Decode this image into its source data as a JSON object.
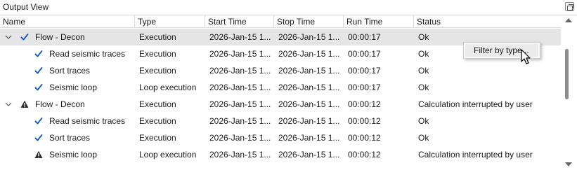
{
  "window": {
    "title": "Output View"
  },
  "columns": [
    "Name",
    "Type",
    "Start Time",
    "Stop Time",
    "Run Time",
    "Status"
  ],
  "rows": [
    {
      "level": 0,
      "expander": "collapse",
      "icon": "check",
      "name": "Flow - Decon",
      "type": "Execution",
      "start": "2026-Jan-15 1...",
      "stop": "2026-Jan-15 1...",
      "run": "00:00:17",
      "status": "Ok"
    },
    {
      "level": 1,
      "expander": "",
      "icon": "check",
      "name": "Read seismic traces",
      "type": "Execution",
      "start": "2026-Jan-15 1...",
      "stop": "2026-Jan-15 1...",
      "run": "00:00:17",
      "status": "Ok"
    },
    {
      "level": 1,
      "expander": "",
      "icon": "check",
      "name": "Sort traces",
      "type": "Execution",
      "start": "2026-Jan-15 1...",
      "stop": "2026-Jan-15 1...",
      "run": "00:00:17",
      "status": "Ok"
    },
    {
      "level": 1,
      "expander": "",
      "icon": "check",
      "name": "Seismic loop",
      "type": "Loop execution",
      "start": "2026-Jan-15 1...",
      "stop": "2026-Jan-15 1...",
      "run": "00:00:17",
      "status": "Ok"
    },
    {
      "level": 0,
      "expander": "collapse",
      "icon": "warning",
      "name": "Flow - Decon",
      "type": "Execution",
      "start": "2026-Jan-15 1...",
      "stop": "2026-Jan-15 1...",
      "run": "00:00:12",
      "status": "Calculation interrupted by user"
    },
    {
      "level": 1,
      "expander": "",
      "icon": "check",
      "name": "Read seismic traces",
      "type": "Execution",
      "start": "2026-Jan-15 1...",
      "stop": "2026-Jan-15 1...",
      "run": "00:00:12",
      "status": "Ok"
    },
    {
      "level": 1,
      "expander": "",
      "icon": "check",
      "name": "Sort traces",
      "type": "Execution",
      "start": "2026-Jan-15 1...",
      "stop": "2026-Jan-15 1...",
      "run": "00:00:12",
      "status": "Ok"
    },
    {
      "level": 1,
      "expander": "",
      "icon": "warning",
      "name": "Seismic loop",
      "type": "Loop execution",
      "start": "2026-Jan-15 1...",
      "stop": "2026-Jan-15 1...",
      "run": "00:00:12",
      "status": "Calculation interrupted by user"
    }
  ],
  "selected_row": 0,
  "context_menu": {
    "items": [
      "Filter by type..."
    ]
  },
  "icons": {
    "check_color": "#1f5fbf",
    "warning_color": "#2b2b2b"
  }
}
